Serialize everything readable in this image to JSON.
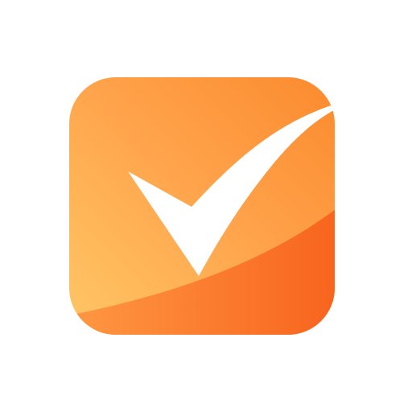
{
  "logo": {
    "icon": "checkbox-check-icon",
    "colors": {
      "tile_light": "#FFC766",
      "tile_mid": "#FFA24A",
      "tile_dark": "#FB8A2E",
      "wave_light": "#FF9A45",
      "wave_dark": "#F7621C",
      "check": "#FFFFFF",
      "background": "#FFFFFF"
    }
  }
}
